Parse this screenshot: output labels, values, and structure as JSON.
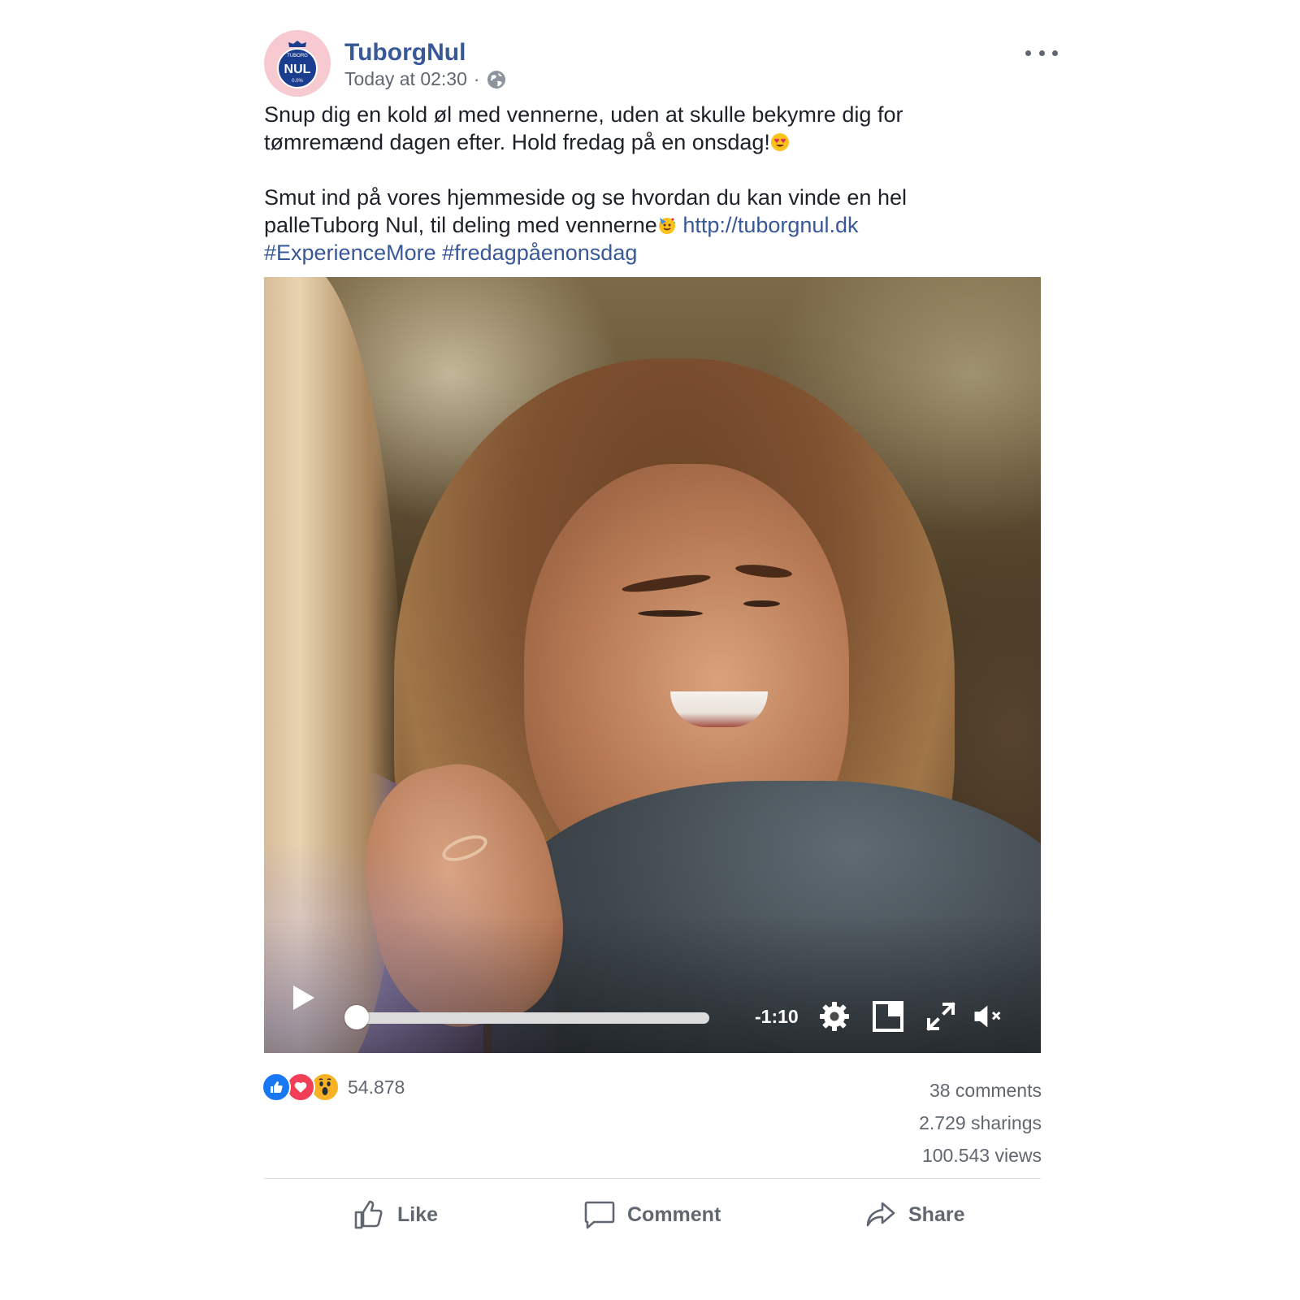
{
  "post": {
    "page_name": "TuborgNul",
    "timestamp": "Today at 02:30",
    "separator": "·",
    "audience_icon": "globe-icon",
    "more_icon": "more-horizontal-icon",
    "avatar_logo_text": "NUL",
    "avatar_logo_top": "TUBORG",
    "avatar_logo_bottom": "0.0%",
    "text": {
      "p1_line1": "Snup dig en kold øl med vennerne, uden at skulle bekymre dig for",
      "p1_line2": "tømremænd dagen efter. Hold fredag på en onsdag!",
      "p1_emoji": "heart-eyes-emoji",
      "p2_line1": "Smut ind på vores hjemmeside og se hvordan du kan vinde en hel",
      "p2_line2": "palleTuborg Nul, til deling med vennerne",
      "p2_emoji": "party-face-emoji",
      "link": "http://tuborgnul.dk",
      "hashtag1": "#ExperienceMore",
      "hashtag2": "#fredagpåenonsdag"
    }
  },
  "video": {
    "remaining_time": "-1:10",
    "progress": 0.02,
    "muted": true,
    "icons": [
      "play-icon",
      "settings-gear-icon",
      "picture-in-picture-icon",
      "fullscreen-icon",
      "volume-muted-icon"
    ]
  },
  "engagement": {
    "reaction_icons": [
      "like-reaction-icon",
      "love-reaction-icon",
      "wow-reaction-icon"
    ],
    "reaction_count": "54.878",
    "comments": "38 comments",
    "shares": "2.729 sharings",
    "views": "100.543 views"
  },
  "actions": {
    "like": "Like",
    "comment": "Comment",
    "share": "Share"
  },
  "colors": {
    "link": "#385898",
    "meta": "#616770",
    "like_blue": "#1877f2",
    "love_red": "#f33e58",
    "wow_yellow": "#f7b125"
  }
}
